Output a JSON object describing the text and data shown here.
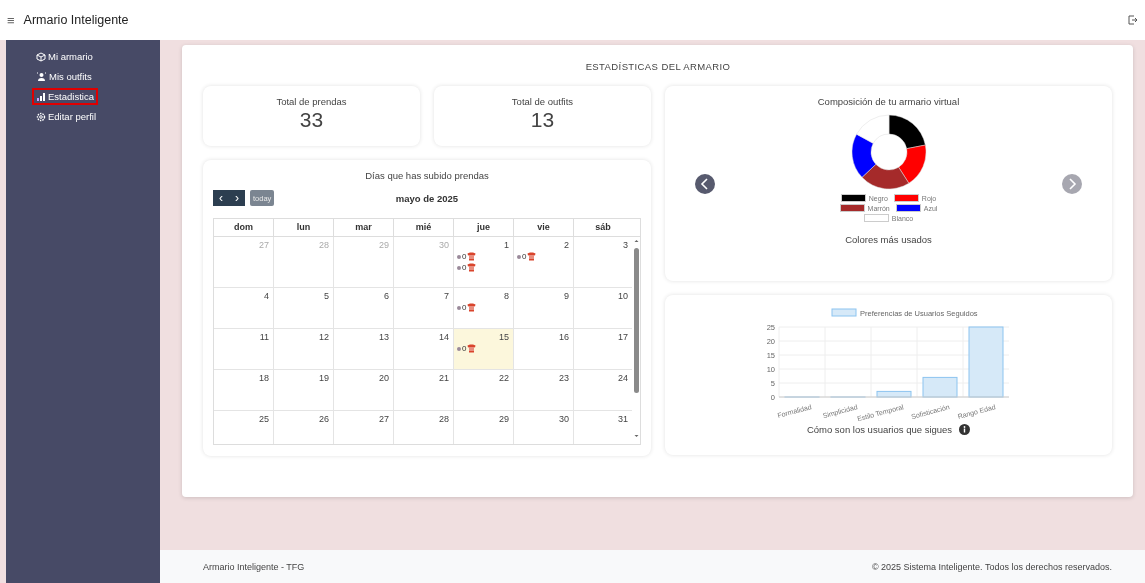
{
  "header": {
    "menu_glyph": "≡",
    "title": "Armario Inteligente"
  },
  "sidebar": {
    "items": [
      {
        "label": "Mi armario",
        "selected": false
      },
      {
        "label": "Mis outfits",
        "selected": false
      },
      {
        "label": "Estadistica",
        "selected": true
      },
      {
        "label": "Editar perfil",
        "selected": false
      }
    ]
  },
  "main": {
    "title": "ESTADÍSTICAS DEL ARMARIO",
    "stats": [
      {
        "label": "Total de prendas",
        "value": "33"
      },
      {
        "label": "Total de outfits",
        "value": "13"
      }
    ],
    "calendar": {
      "title": "Días que has subido prendas",
      "prev_glyph": "‹",
      "next_glyph": "›",
      "today_label": "today",
      "month": "mayo de 2025",
      "weekdays": [
        "dom",
        "lun",
        "mar",
        "mié",
        "jue",
        "vie",
        "sáb"
      ],
      "weeks": [
        [
          {
            "day": "27",
            "other_month": true,
            "today": false
          },
          {
            "day": "28",
            "other_month": true,
            "today": false
          },
          {
            "day": "29",
            "other_month": true,
            "today": false
          },
          {
            "day": "30",
            "other_month": true,
            "today": false
          },
          {
            "day": "1",
            "other_month": false,
            "today": false,
            "events": [
              {
                "count": "0"
              },
              {
                "count": "0"
              }
            ]
          },
          {
            "day": "2",
            "other_month": false,
            "today": false,
            "events": [
              {
                "count": "0"
              }
            ]
          },
          {
            "day": "3",
            "other_month": false,
            "today": false
          }
        ],
        [
          {
            "day": "4",
            "other_month": false,
            "today": false
          },
          {
            "day": "5",
            "other_month": false,
            "today": false
          },
          {
            "day": "6",
            "other_month": false,
            "today": false
          },
          {
            "day": "7",
            "other_month": false,
            "today": false
          },
          {
            "day": "8",
            "other_month": false,
            "today": false,
            "events": [
              {
                "count": "0"
              }
            ]
          },
          {
            "day": "9",
            "other_month": false,
            "today": false
          },
          {
            "day": "10",
            "other_month": false,
            "today": false
          }
        ],
        [
          {
            "day": "11",
            "other_month": false,
            "today": false
          },
          {
            "day": "12",
            "other_month": false,
            "today": false
          },
          {
            "day": "13",
            "other_month": false,
            "today": false
          },
          {
            "day": "14",
            "other_month": false,
            "today": false
          },
          {
            "day": "15",
            "other_month": false,
            "today": true,
            "events": [
              {
                "count": "0"
              }
            ]
          },
          {
            "day": "16",
            "other_month": false,
            "today": false
          },
          {
            "day": "17",
            "other_month": false,
            "today": false
          }
        ],
        [
          {
            "day": "18",
            "other_month": false,
            "today": false
          },
          {
            "day": "19",
            "other_month": false,
            "today": false
          },
          {
            "day": "20",
            "other_month": false,
            "today": false
          },
          {
            "day": "21",
            "other_month": false,
            "today": false
          },
          {
            "day": "22",
            "other_month": false,
            "today": false
          },
          {
            "day": "23",
            "other_month": false,
            "today": false
          },
          {
            "day": "24",
            "other_month": false,
            "today": false
          }
        ],
        [
          {
            "day": "25",
            "other_month": false,
            "today": false
          },
          {
            "day": "26",
            "other_month": false,
            "today": false
          },
          {
            "day": "27",
            "other_month": false,
            "today": false
          },
          {
            "day": "28",
            "other_month": false,
            "today": false
          },
          {
            "day": "29",
            "other_month": false,
            "today": false
          },
          {
            "day": "30",
            "other_month": false,
            "today": false
          },
          {
            "day": "31",
            "other_month": false,
            "today": false
          }
        ]
      ]
    },
    "composition": {
      "title": "Composición de tu armario virtual",
      "caption": "Colores más usados",
      "legend": [
        {
          "label": "Negro",
          "color": "#000000"
        },
        {
          "label": "Rojo",
          "color": "#ff0000"
        },
        {
          "label": "Marrón",
          "color": "#a52a2a"
        },
        {
          "label": "Azul",
          "color": "#0000ff"
        },
        {
          "label": "Blanco",
          "color": "#ffffff"
        }
      ]
    },
    "preferences": {
      "caption": "Cómo son los usuarios que sigues",
      "chart_data": {
        "type": "bar",
        "categories": [
          "Formalidad",
          "Simplicidad",
          "Estilo Temporal",
          "Sofisticación",
          "Rango Edad"
        ],
        "series": [
          {
            "name": "Preferencias de Usuarios Seguidos",
            "color": "#d6e9f8",
            "values": [
              0,
              0,
              2,
              7,
              25
            ]
          }
        ],
        "ylim": [
          0,
          25
        ],
        "yticks": [
          0,
          5,
          10,
          15,
          20,
          25
        ],
        "grid": true
      }
    }
  },
  "footer": {
    "left": "Armario Inteligente - TFG",
    "right": "© 2025 Sistema Inteligente. Todos los derechos reservados."
  }
}
